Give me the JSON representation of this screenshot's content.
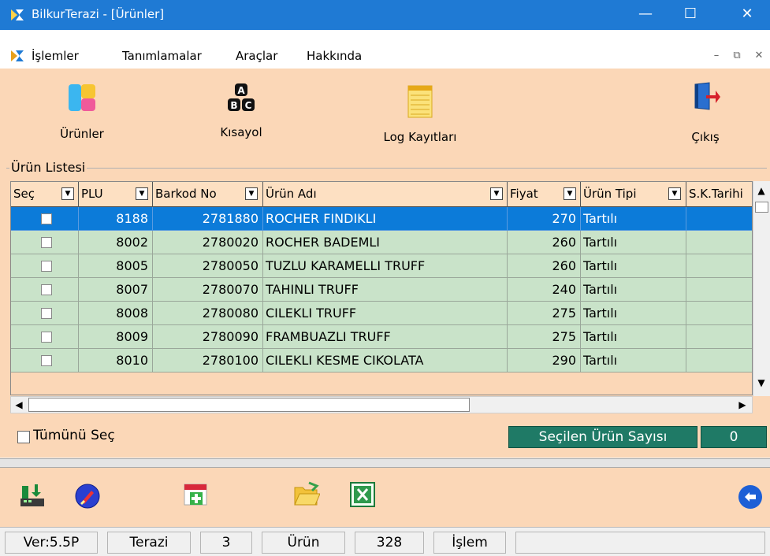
{
  "window": {
    "title": "BilkurTerazi  - [Ürünler]",
    "minimize": "—",
    "maximize": "☐",
    "close": "✕"
  },
  "menu": {
    "items": [
      "İşlemler",
      "Tanımlamalar",
      "Araçlar",
      "Hakkında"
    ],
    "mdi_minimize": "–",
    "mdi_restore": "⧉",
    "mdi_close": "✕"
  },
  "toolbar": {
    "products": "Ürünler",
    "shortcut": "Kısayol",
    "logs": "Log Kayıtları",
    "exit": "Çıkış"
  },
  "list": {
    "group_title": "Ürün Listesi",
    "headers": [
      "Seç",
      "PLU",
      "Barkod No",
      "Ürün Adı",
      "Fiyat",
      "Ürün Tipi",
      "S.K.Tarihi"
    ],
    "rows": [
      {
        "plu": "8188",
        "barcode": "2781880",
        "name": "ROCHER FINDIKLI",
        "price": "270",
        "type": "Tartılı",
        "selected": true
      },
      {
        "plu": "8002",
        "barcode": "2780020",
        "name": "ROCHER BADEMLI",
        "price": "260",
        "type": "Tartılı",
        "selected": false
      },
      {
        "plu": "8005",
        "barcode": "2780050",
        "name": "TUZLU KARAMELLI TRUFF",
        "price": "260",
        "type": "Tartılı",
        "selected": false
      },
      {
        "plu": "8007",
        "barcode": "2780070",
        "name": "TAHINLI TRUFF",
        "price": "240",
        "type": "Tartılı",
        "selected": false
      },
      {
        "plu": "8008",
        "barcode": "2780080",
        "name": "CILEKLI TRUFF",
        "price": "275",
        "type": "Tartılı",
        "selected": false
      },
      {
        "plu": "8009",
        "barcode": "2780090",
        "name": "FRAMBUAZLI TRUFF",
        "price": "275",
        "type": "Tartılı",
        "selected": false
      },
      {
        "plu": "8010",
        "barcode": "2780100",
        "name": "CILEKLI KESME CIKOLATA",
        "price": "290",
        "type": "Tartılı",
        "selected": false
      }
    ]
  },
  "footer": {
    "select_all": "Tümünü Seç",
    "selected_count_label": "Seçilen Ürün Sayısı",
    "selected_count": "0"
  },
  "status": {
    "version": "Ver:5.5P",
    "scale_label": "Terazi",
    "scale_count": "3",
    "product_label": "Ürün",
    "product_count": "328",
    "operation_label": "İşlem"
  },
  "colors": {
    "titlebar": "#1f7ad4",
    "panel": "#fbd7b7",
    "row": "#c9e3c9",
    "row_selected": "#0c7bd9",
    "count_badge": "#1f7a66"
  }
}
